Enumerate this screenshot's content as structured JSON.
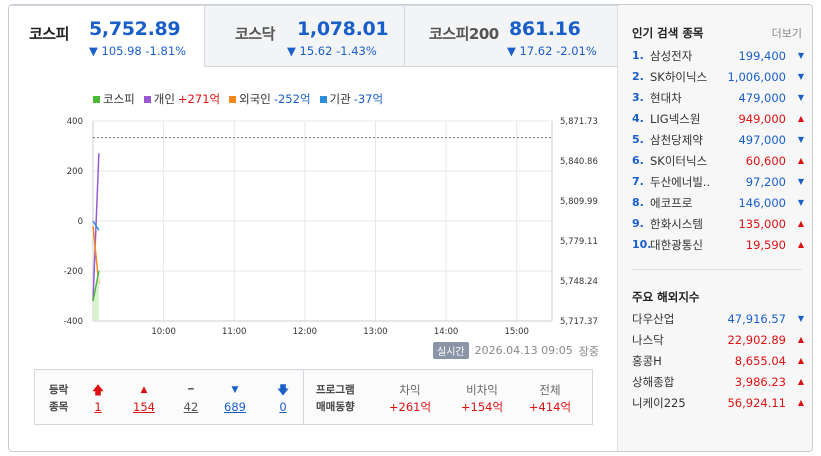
{
  "tabs": [
    {
      "name": "코스피",
      "value": "5,752.89",
      "change": "▼ 105.98 -1.81%"
    },
    {
      "name": "코스닥",
      "value": "1,078.01",
      "change": "▼ 15.62 -1.43%"
    },
    {
      "name": "코스피200",
      "value": "861.16",
      "change": "▼ 17.62 -2.01%"
    }
  ],
  "legend": [
    {
      "label": "코스피",
      "value": "",
      "color": "#4bb838"
    },
    {
      "label": "개인",
      "value": "+271억",
      "color": "#9b59d0"
    },
    {
      "label": "외국인",
      "value": "-252억",
      "color": "#f5891f"
    },
    {
      "label": "기관",
      "value": "-37억",
      "color": "#2d8fdb"
    }
  ],
  "chart_data": {
    "type": "line",
    "x_ticks": [
      "10:00",
      "11:00",
      "12:00",
      "13:00",
      "14:00",
      "15:00"
    ],
    "x_range": [
      "09:00",
      "15:30"
    ],
    "y_left_ticks": [
      "400",
      "200",
      "0",
      "-200",
      "-400"
    ],
    "y_left_range": [
      -400,
      400
    ],
    "y_right_ticks": [
      "5,871.73",
      "5,840.86",
      "5,809.99",
      "5,779.11",
      "5,748.24",
      "5,717.37"
    ],
    "y_right_range": [
      5717.37,
      5871.73
    ],
    "reference_line": 5858.87,
    "series": [
      {
        "name": "개인",
        "axis": "left",
        "color": "#9b59d0",
        "x": [
          "09:00",
          "09:05"
        ],
        "values": [
          -320,
          271
        ]
      },
      {
        "name": "외국인",
        "axis": "left",
        "color": "#f5891f",
        "x": [
          "09:00",
          "09:05"
        ],
        "values": [
          -20,
          -252
        ]
      },
      {
        "name": "기관",
        "axis": "left",
        "color": "#2d8fdb",
        "x": [
          "09:00",
          "09:05"
        ],
        "values": [
          0,
          -37
        ]
      },
      {
        "name": "코스피",
        "axis": "left",
        "color": "#4bb838",
        "x": [
          "09:00",
          "09:05"
        ],
        "values": [
          -320,
          -200
        ]
      }
    ],
    "grid": true
  },
  "status": {
    "badge": "실시간",
    "datetime": "2026.04.13 09:05",
    "session": "장중"
  },
  "breadth": {
    "label_line1": "등락",
    "label_line2": "종목",
    "items": [
      {
        "icon": "🡅",
        "value": "1",
        "dir": "up"
      },
      {
        "icon": "▲",
        "value": "154",
        "dir": "up"
      },
      {
        "icon": "━",
        "value": "42",
        "dir": "flat"
      },
      {
        "icon": "▼",
        "value": "689",
        "dir": "dn"
      },
      {
        "icon": "🡇",
        "value": "0",
        "dir": "dn"
      }
    ]
  },
  "program": {
    "label_line1": "프로그램",
    "label_line2": "매매동향",
    "items": [
      {
        "header": "차익",
        "value": "+261억"
      },
      {
        "header": "비차익",
        "value": "+154억"
      },
      {
        "header": "전체",
        "value": "+414억"
      }
    ]
  },
  "popular": {
    "title": "인기 검색 종목",
    "more": "더보기",
    "items": [
      {
        "rank": "1.",
        "name": "삼성전자",
        "price": "199,400",
        "dir": "dn"
      },
      {
        "rank": "2.",
        "name": "SK하이닉스",
        "price": "1,006,000",
        "dir": "dn"
      },
      {
        "rank": "3.",
        "name": "현대차",
        "price": "479,000",
        "dir": "dn"
      },
      {
        "rank": "4.",
        "name": "LIG넥스원",
        "price": "949,000",
        "dir": "up"
      },
      {
        "rank": "5.",
        "name": "삼천당제약",
        "price": "497,000",
        "dir": "dn"
      },
      {
        "rank": "6.",
        "name": "SK이터닉스",
        "price": "60,600",
        "dir": "up"
      },
      {
        "rank": "7.",
        "name": "두산에너빌..",
        "price": "97,200",
        "dir": "dn"
      },
      {
        "rank": "8.",
        "name": "에코프로",
        "price": "146,000",
        "dir": "dn"
      },
      {
        "rank": "9.",
        "name": "한화시스템",
        "price": "135,000",
        "dir": "up"
      },
      {
        "rank": "10.",
        "name": "대한광통신",
        "price": "19,590",
        "dir": "up"
      }
    ]
  },
  "overseas": {
    "title": "주요 해외지수",
    "items": [
      {
        "name": "다우산업",
        "price": "47,916.57",
        "dir": "dn"
      },
      {
        "name": "나스닥",
        "price": "22,902.89",
        "dir": "up"
      },
      {
        "name": "홍콩H",
        "price": "8,655.04",
        "dir": "up"
      },
      {
        "name": "상해종합",
        "price": "3,986.23",
        "dir": "up"
      },
      {
        "name": "니케이225",
        "price": "56,924.11",
        "dir": "up"
      }
    ]
  },
  "colors": {
    "up": "#dd1111",
    "down": "#1a5fc7",
    "grid": "#e6e8eb"
  }
}
